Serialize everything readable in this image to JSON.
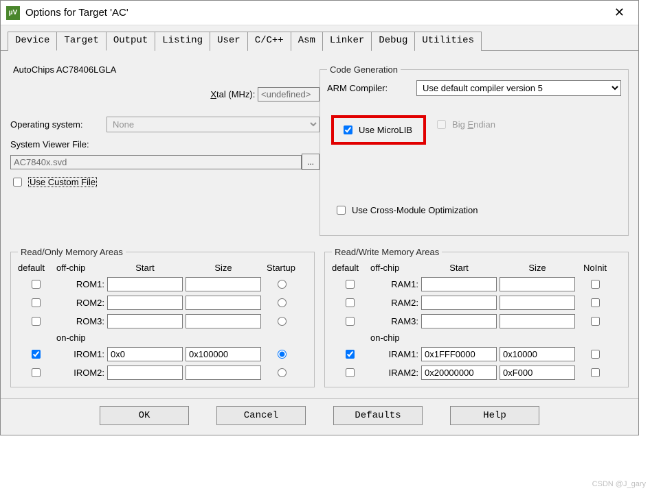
{
  "title": "Options for Target 'AC'",
  "tabs": [
    "Device",
    "Target",
    "Output",
    "Listing",
    "User",
    "C/C++",
    "Asm",
    "Linker",
    "Debug",
    "Utilities"
  ],
  "active_tab": "Target",
  "device_name": "AutoChips AC78406LGLA",
  "xtal_label": "Xtal (MHz):",
  "xtal_value": "<undefined>",
  "os_label": "Operating system:",
  "os_value": "None",
  "svf_label": "System Viewer File:",
  "svf_value": "AC7840x.svd",
  "use_custom_file": "Use Custom File",
  "codegen": {
    "legend": "Code Generation",
    "compiler_label": "ARM Compiler:",
    "compiler_value": "Use default compiler version 5",
    "use_microlib": "Use MicroLIB",
    "big_endian": "Big Endian",
    "cross_module": "Use Cross-Module Optimization"
  },
  "ro_legend": "Read/Only Memory Areas",
  "rw_legend": "Read/Write Memory Areas",
  "headers": {
    "default": "default",
    "offchip": "off-chip",
    "start": "Start",
    "size": "Size",
    "startup": "Startup",
    "onchip": "on-chip",
    "noinit": "NoInit"
  },
  "ro_rows": [
    {
      "name": "ROM1:",
      "default": false,
      "start": "",
      "size": "",
      "startup": false
    },
    {
      "name": "ROM2:",
      "default": false,
      "start": "",
      "size": "",
      "startup": false
    },
    {
      "name": "ROM3:",
      "default": false,
      "start": "",
      "size": "",
      "startup": false
    }
  ],
  "ro_onchip_rows": [
    {
      "name": "IROM1:",
      "default": true,
      "start": "0x0",
      "size": "0x100000",
      "startup": true
    },
    {
      "name": "IROM2:",
      "default": false,
      "start": "",
      "size": "",
      "startup": false
    }
  ],
  "rw_rows": [
    {
      "name": "RAM1:",
      "default": false,
      "start": "",
      "size": "",
      "noinit": false
    },
    {
      "name": "RAM2:",
      "default": false,
      "start": "",
      "size": "",
      "noinit": false
    },
    {
      "name": "RAM3:",
      "default": false,
      "start": "",
      "size": "",
      "noinit": false
    }
  ],
  "rw_onchip_rows": [
    {
      "name": "IRAM1:",
      "default": true,
      "start": "0x1FFF0000",
      "size": "0x10000",
      "noinit": false
    },
    {
      "name": "IRAM2:",
      "default": false,
      "start": "0x20000000",
      "size": "0xF000",
      "noinit": false
    }
  ],
  "buttons": {
    "ok": "OK",
    "cancel": "Cancel",
    "defaults": "Defaults",
    "help": "Help"
  },
  "watermark": "CSDN @J_gary"
}
